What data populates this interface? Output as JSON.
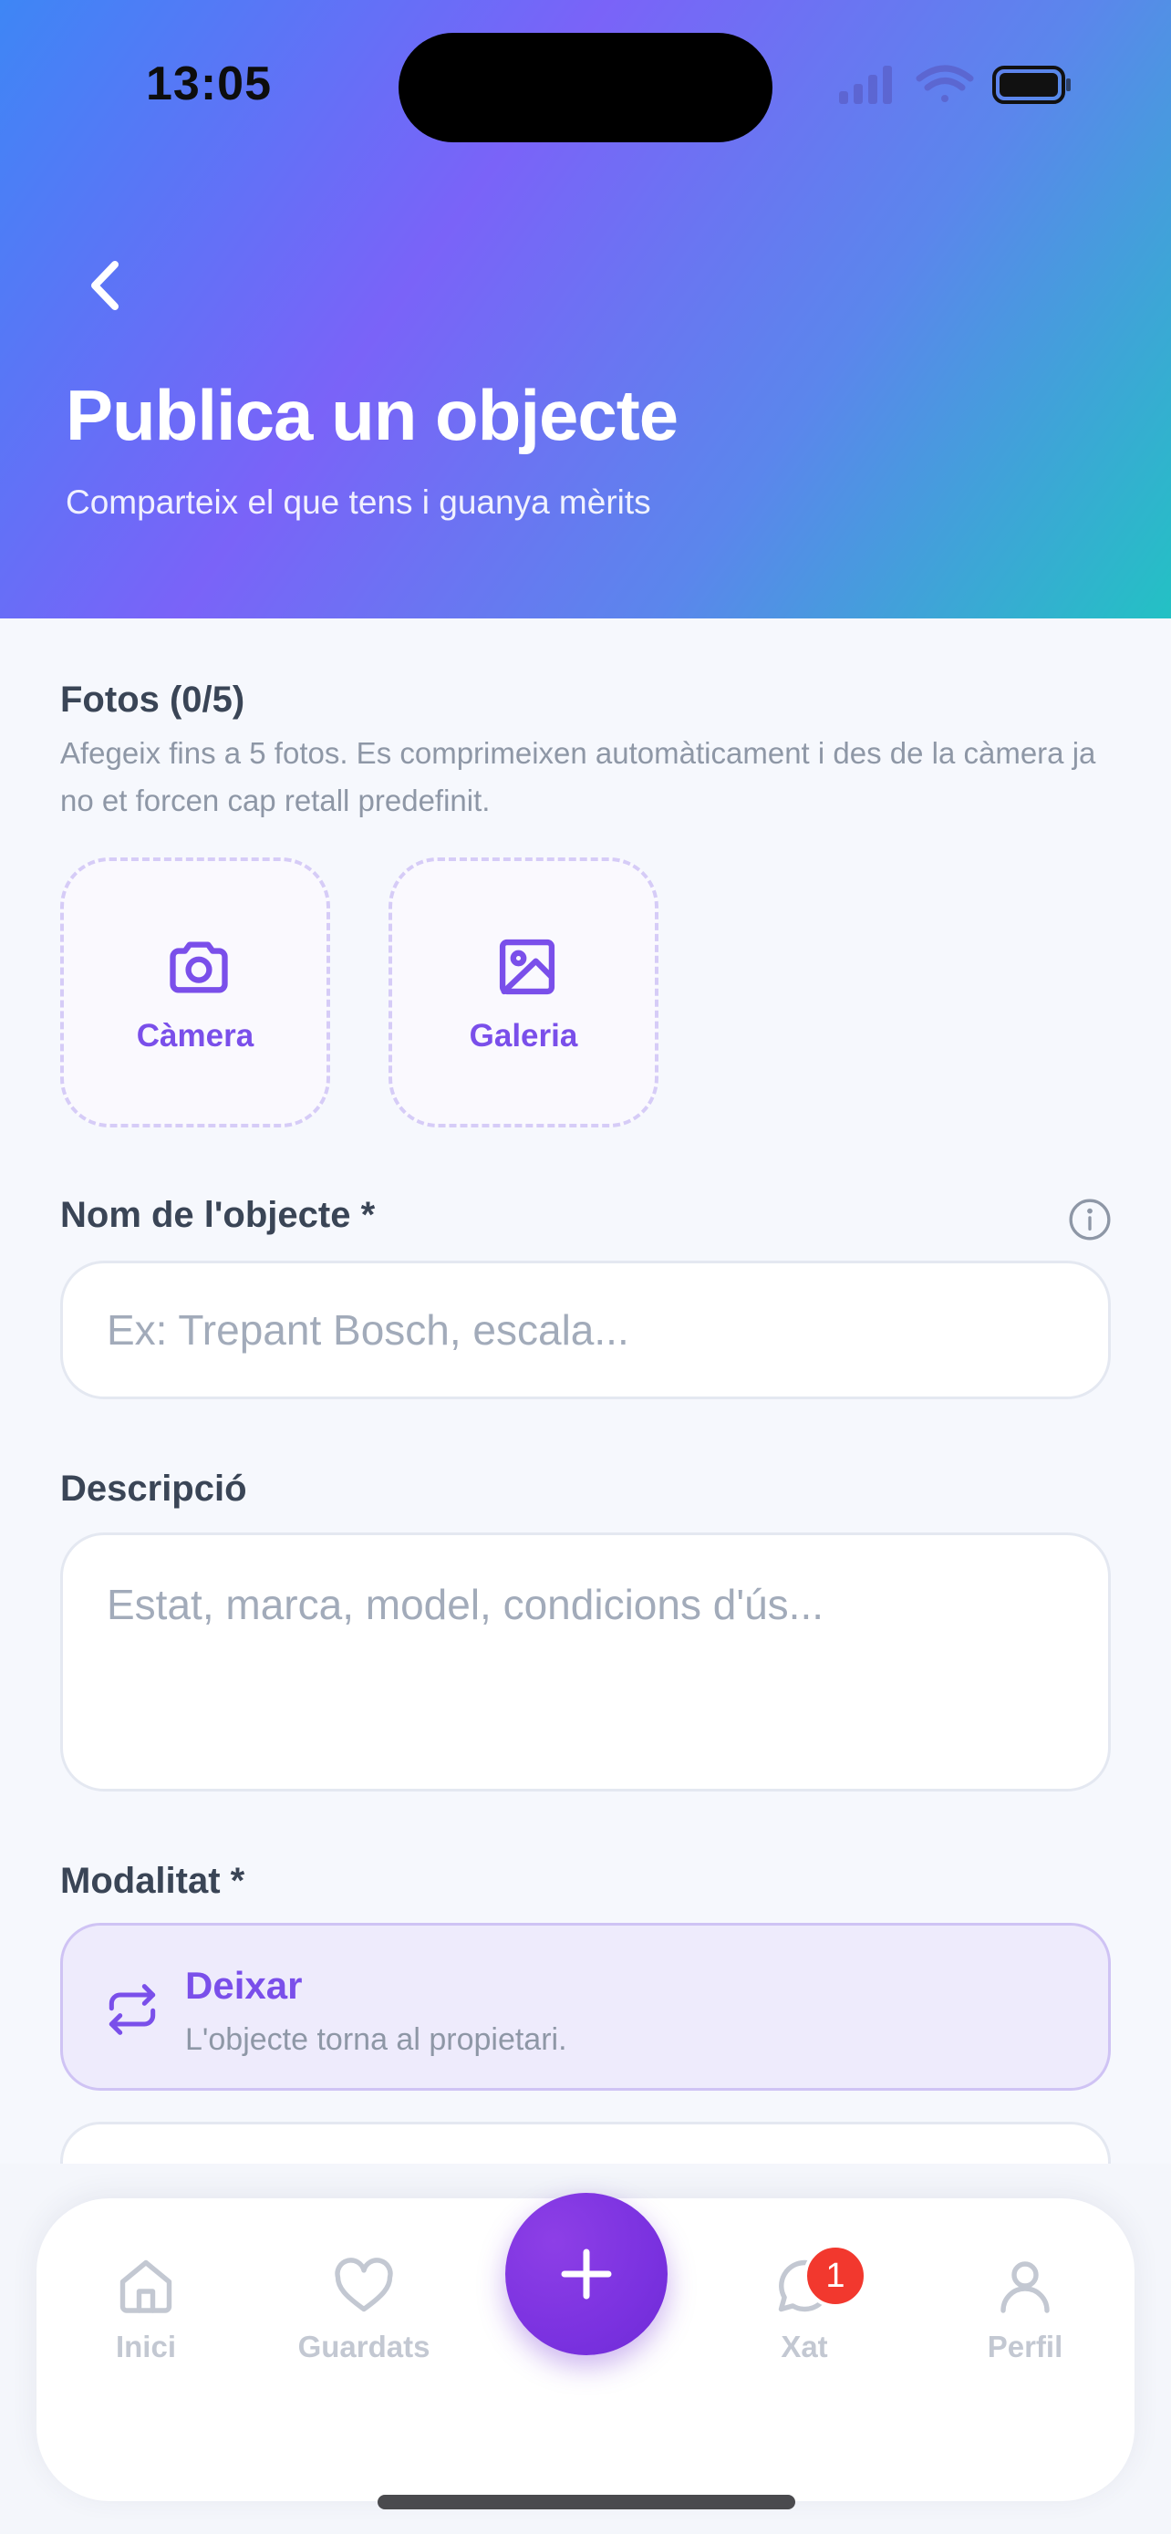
{
  "status_bar": {
    "time": "13:05"
  },
  "header": {
    "title": "Publica un objecte",
    "subtitle": "Comparteix el que tens i guanya mèrits"
  },
  "photos": {
    "label": "Fotos (0/5)",
    "helper": "Afegeix fins a 5 fotos. Es comprimeixen automàticament i des de la càmera ja no et forcen cap retall predefinit.",
    "camera_label": "Càmera",
    "gallery_label": "Galeria"
  },
  "name_field": {
    "label": "Nom de l'objecte *",
    "placeholder": "Ex: Trepant Bosch, escala..."
  },
  "description_field": {
    "label": "Descripció",
    "placeholder": "Estat, marca, model, condicions d'ús..."
  },
  "modality": {
    "label": "Modalitat *",
    "options": [
      {
        "title": "Deixar",
        "subtitle": "L'objecte torna al propietari."
      }
    ]
  },
  "tabbar": {
    "items": [
      {
        "label": "Inici",
        "icon": "home-icon"
      },
      {
        "label": "Guardats",
        "icon": "heart-icon"
      },
      {
        "label": "Xat",
        "icon": "chat-icon",
        "badge": "1"
      },
      {
        "label": "Perfil",
        "icon": "user-icon"
      }
    ],
    "fab_icon": "plus-icon"
  },
  "colors": {
    "accent": "#7A4FEA",
    "header_gradient_start": "#3E86F5",
    "header_gradient_mid": "#7A63F8",
    "header_gradient_end": "#23C1C4",
    "badge": "#F2382E"
  }
}
